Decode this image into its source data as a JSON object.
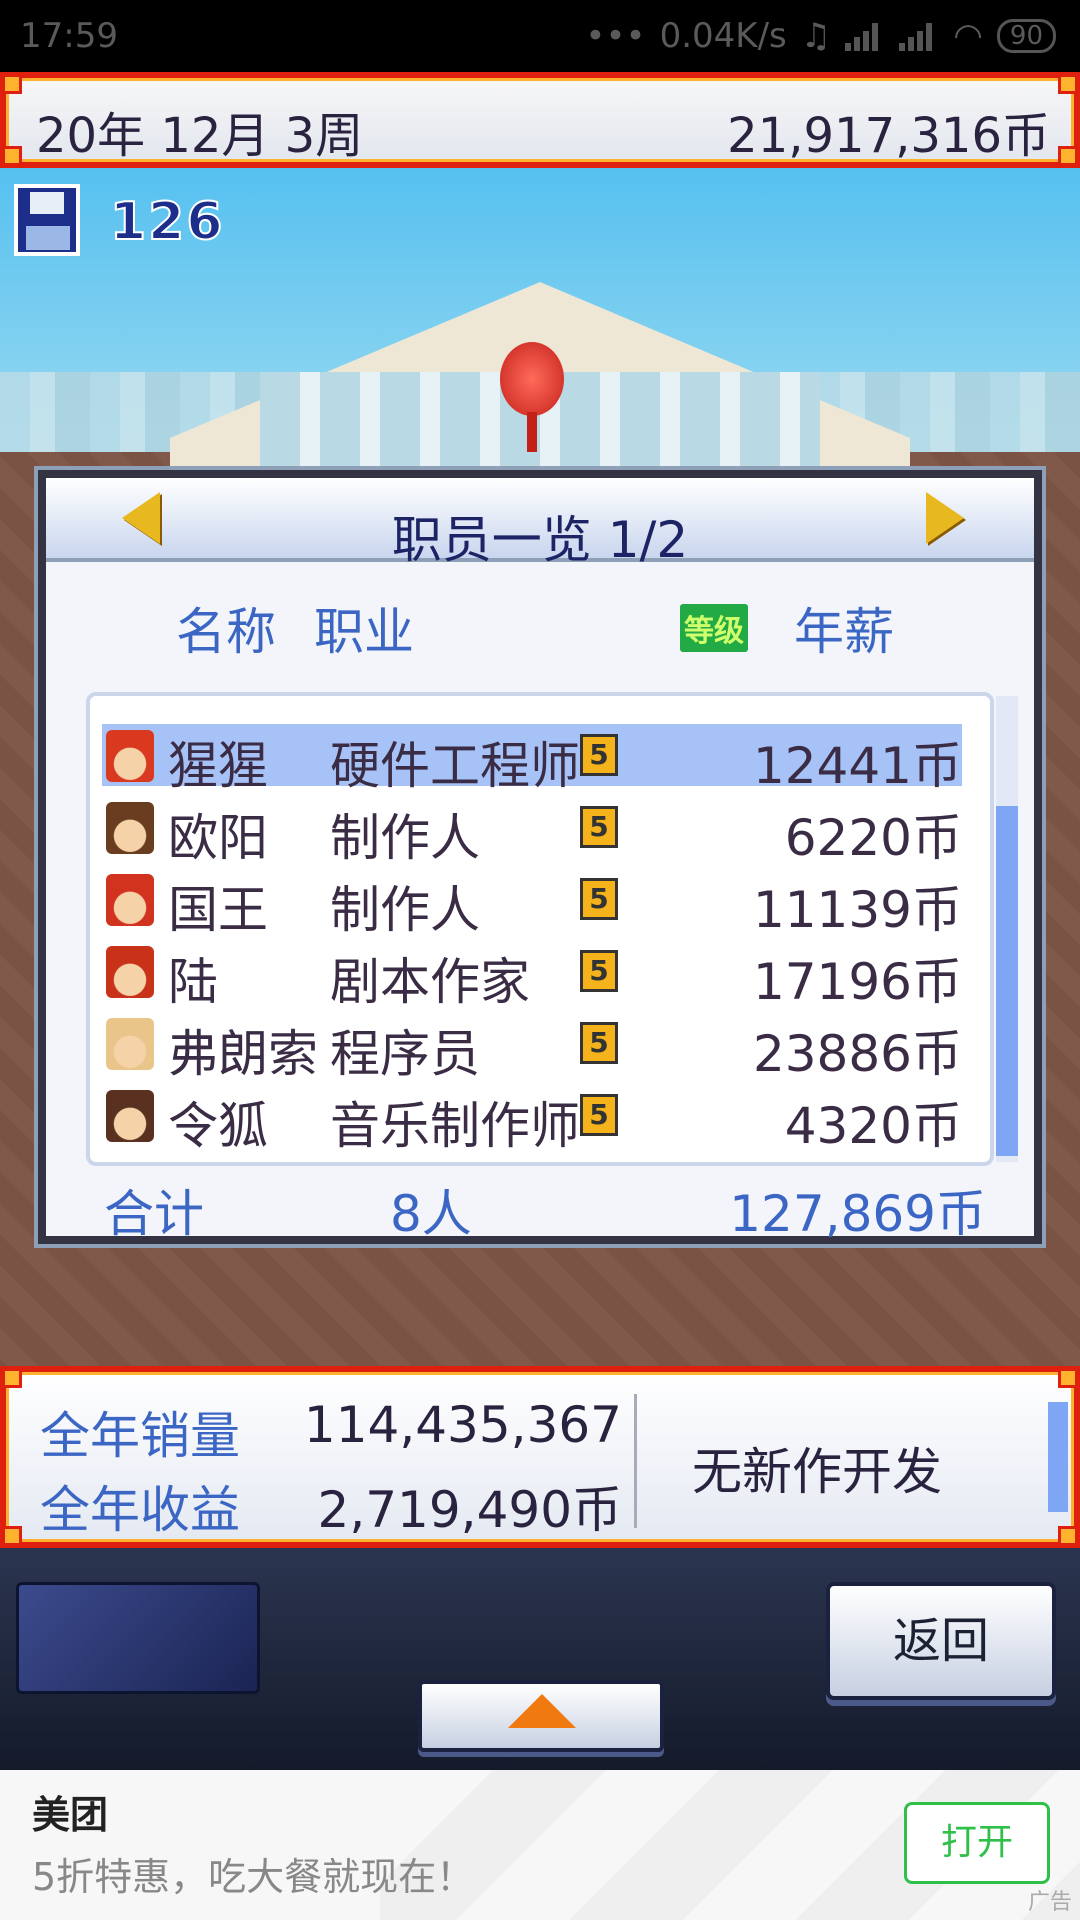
{
  "status_bar": {
    "time": "17:59",
    "net_speed": "0.04K/s",
    "battery": "90"
  },
  "top_bar": {
    "date": "20年 12月 3周",
    "money": "21,917,316币"
  },
  "save": {
    "count": "126",
    "icon": "floppy-disk-icon"
  },
  "staff_panel": {
    "title": "职员一览 1/2",
    "headers": {
      "name": "名称",
      "job": "职业",
      "level": "等级",
      "salary": "年薪"
    },
    "rows": [
      {
        "name": "猩猩",
        "job": "硬件工程师",
        "level": "5",
        "salary": "12441币",
        "avatar_color": "#d93a1f"
      },
      {
        "name": "欧阳",
        "job": "制作人",
        "level": "5",
        "salary": "6220币",
        "avatar_color": "#6b3d20"
      },
      {
        "name": "国王",
        "job": "制作人",
        "level": "5",
        "salary": "11139币",
        "avatar_color": "#d2331f"
      },
      {
        "name": "陆",
        "job": "剧本作家",
        "level": "5",
        "salary": "17196币",
        "avatar_color": "#c83219"
      },
      {
        "name": "弗朗索",
        "job": "程序员",
        "level": "5",
        "salary": "23886币",
        "avatar_color": "#e9c58a"
      },
      {
        "name": "令狐",
        "job": "音乐制作师",
        "level": "5",
        "salary": "4320币",
        "avatar_color": "#5a3020"
      }
    ],
    "total_label": "合计",
    "total_count": "8人",
    "total_salary": "127,869币"
  },
  "info_bar": {
    "sales_label": "全年销量",
    "sales_value": "114,435,367",
    "revenue_label": "全年收益",
    "revenue_value": "2,719,490币",
    "status": "无新作开发"
  },
  "controls": {
    "back_label": "返回"
  },
  "ad": {
    "brand": "美团",
    "text": "5折特惠，吃大餐就现在！",
    "open_label": "打开",
    "tag": "广告"
  }
}
